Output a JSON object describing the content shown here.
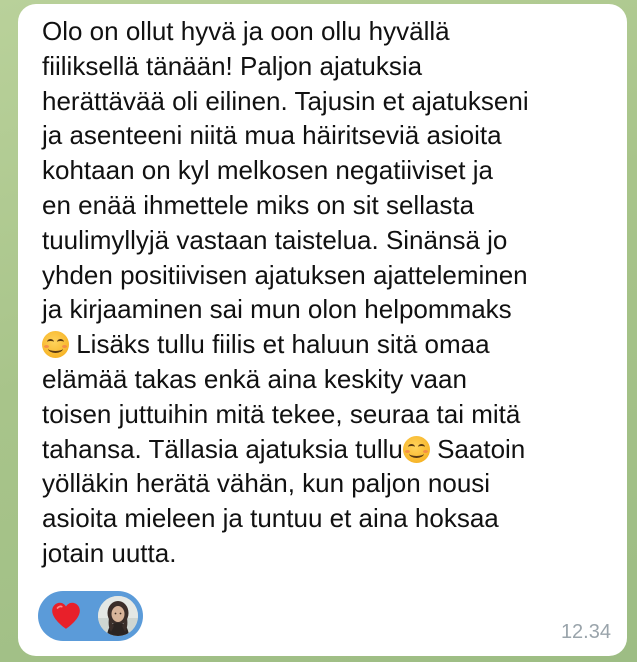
{
  "message": {
    "lines": [
      "Olo on ollut hyvä ja oon ollu hyvällä",
      "fiiliksellä tänään! Paljon ajatuksia",
      "herättävää oli eilinen. Tajusin et ajatukseni",
      "ja asenteeni niitä mua häiritseviä asioita",
      "kohtaan on kyl melkosen negatiiviset ja",
      "en enää ihmettele miks on sit sellasta",
      "tuulimyllyjä vastaan taistelua. Sinänsä jo",
      "yhden positiivisen ajatuksen ajatteleminen",
      "ja kirjaaminen sai mun olon helpommaks"
    ],
    "line10": " Lisäks tullu fiilis et haluun sitä omaa",
    "lines_mid": [
      "elämää takas enkä aina keskity vaan",
      "toisen juttuihin mitä tekee, seuraa tai mitä"
    ],
    "line13_before": "tahansa. Tällasia ajatuksia tullu",
    "line13_after": " Saatoin",
    "lines_end": [
      "yölläkin herätä vähän, kun paljon nousi",
      "asioita mieleen ja tuntuu et aina hoksaa",
      "jotain uutta."
    ],
    "timestamp": "12.34"
  },
  "icons": {
    "emoji": "smiling-face-with-smiling-eyes",
    "reaction": "red-heart",
    "avatar": "user-avatar"
  },
  "colors": {
    "bubble": "#ffffff",
    "reaction_pill": "#5b9bd9",
    "heart": "#e8202a",
    "timestamp": "#9aa4ab"
  }
}
